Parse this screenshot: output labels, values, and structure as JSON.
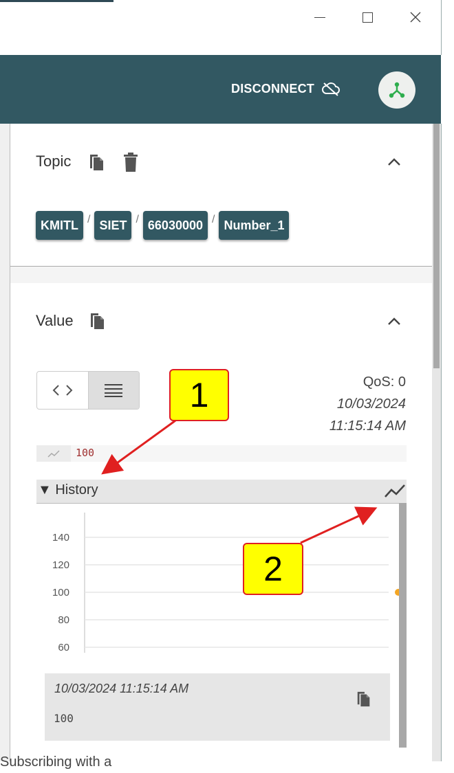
{
  "window": {
    "controls": {
      "minimize": "—",
      "maximize": "☐",
      "close": "✕"
    }
  },
  "header": {
    "disconnect_label": "DISCONNECT",
    "disconnect_icon": "cloud-off-icon",
    "avatar_icon": "mqtt-hub-icon",
    "accent_color": "#325862"
  },
  "topic": {
    "title": "Topic",
    "path": [
      "KMITL",
      "SIET",
      "66030000",
      "Number_1"
    ],
    "separator": "/"
  },
  "value": {
    "title": "Value",
    "qos": "QoS: 0",
    "date": "10/03/2024",
    "time": "11:15:14 AM",
    "current_value": "100",
    "history_label": "▼ History",
    "record": {
      "timestamp": "10/03/2024 11:15:14 AM",
      "value": "100"
    }
  },
  "chart_data": {
    "type": "scatter",
    "y_ticks": [
      "140",
      "120",
      "100",
      "80",
      "60"
    ],
    "ylim": [
      60,
      140
    ],
    "points": [
      {
        "y": 100
      }
    ],
    "point_color": "#f5a623",
    "grid": true
  },
  "annotations": {
    "callout_1": "1",
    "callout_2": "2"
  },
  "bottom_text": "Subscribing with a"
}
